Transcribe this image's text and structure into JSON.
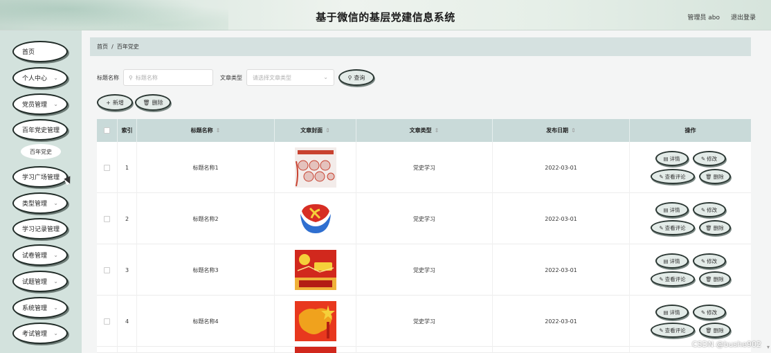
{
  "header": {
    "title": "基于微信的基层党建信息系统",
    "user": "管理员 abo",
    "logout": "退出登录"
  },
  "sidebar": {
    "items": [
      {
        "label": "首页",
        "chevron": ""
      },
      {
        "label": "个人中心",
        "chevron": "⌄"
      },
      {
        "label": "党员管理",
        "chevron": "⌄"
      },
      {
        "label": "百年党史管理",
        "chevron": ""
      },
      {
        "label": "学习广场管理",
        "chevron": ""
      },
      {
        "label": "类型管理",
        "chevron": "⌄"
      },
      {
        "label": "学习记录管理",
        "chevron": ""
      },
      {
        "label": "试卷管理",
        "chevron": "⌄"
      },
      {
        "label": "试题管理",
        "chevron": "⌄"
      },
      {
        "label": "系统管理",
        "chevron": "⌄"
      },
      {
        "label": "考试管理",
        "chevron": "⌄"
      }
    ],
    "submenu": "百年党史"
  },
  "breadcrumb": {
    "home": "首页",
    "sep": "/",
    "current": "百年党史"
  },
  "search": {
    "title_label": "标题名称",
    "title_placeholder": "标题名称",
    "type_label": "文章类型",
    "type_placeholder": "请选择文章类型",
    "query_button": "查询"
  },
  "actions": {
    "add": "新增",
    "delete": "删除"
  },
  "table": {
    "columns": {
      "index": "索引",
      "title": "标题名称",
      "cover": "文章封面",
      "type": "文章类型",
      "date": "发布日期",
      "ops": "操作"
    },
    "rows": [
      {
        "index": "1",
        "title": "标题名称1",
        "type": "党史学习",
        "date": "2022-03-01"
      },
      {
        "index": "2",
        "title": "标题名称2",
        "type": "党史学习",
        "date": "2022-03-01"
      },
      {
        "index": "3",
        "title": "标题名称3",
        "type": "党史学习",
        "date": "2022-03-01"
      },
      {
        "index": "4",
        "title": "标题名称4",
        "type": "党史学习",
        "date": "2022-03-01"
      }
    ],
    "op_labels": {
      "detail": "详情",
      "edit": "修改",
      "comments": "查看评论",
      "delete": "删除"
    }
  },
  "watermark": "CSDN @bushe902",
  "colors": {
    "sidebar_bg": "#d3e2dd",
    "table_header_bg": "#c9dad9",
    "breadcrumb_bg": "#d5e1e0",
    "button_bg": "#e3ebe8"
  }
}
